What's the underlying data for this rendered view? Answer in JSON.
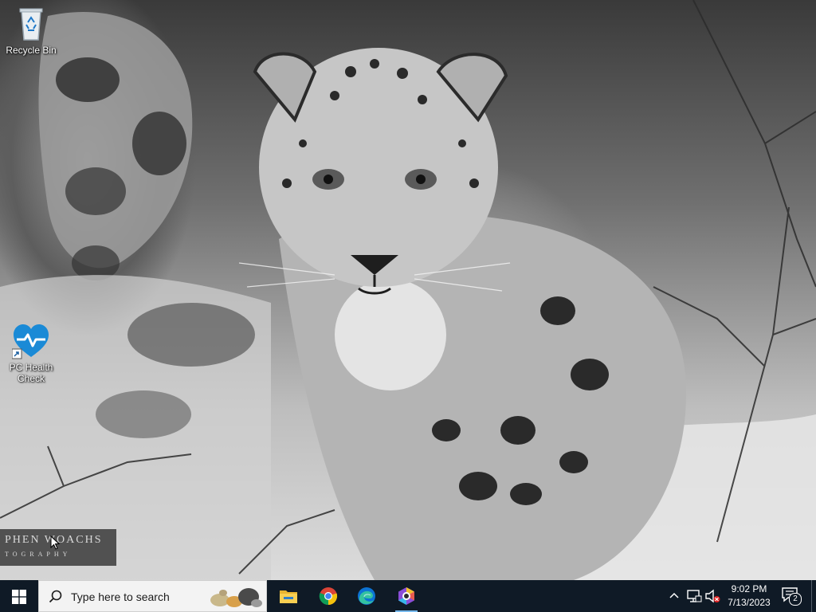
{
  "desktop": {
    "icons": [
      {
        "label": "Recycle Bin",
        "icon": "recycle-bin-icon"
      },
      {
        "label": "PC Health Check",
        "icon": "heart-pulse-icon"
      }
    ],
    "watermark": {
      "line1": "PHEN WOACHS",
      "line2": "TOGRAPHY"
    }
  },
  "taskbar": {
    "search_placeholder": "Type here to search",
    "apps": [
      {
        "name": "File Explorer",
        "icon": "folder-icon"
      },
      {
        "name": "Google Chrome",
        "icon": "chrome-icon"
      },
      {
        "name": "Microsoft Edge",
        "icon": "edge-icon"
      },
      {
        "name": "App",
        "icon": "hexagon-app-icon"
      }
    ],
    "clock": {
      "time": "9:02 PM",
      "date": "7/13/2023"
    },
    "notification_count": "2"
  },
  "colors": {
    "taskbar_bg": "#0f1a26",
    "accent": "#76b9ed",
    "health_blue": "#1a8ad6"
  }
}
